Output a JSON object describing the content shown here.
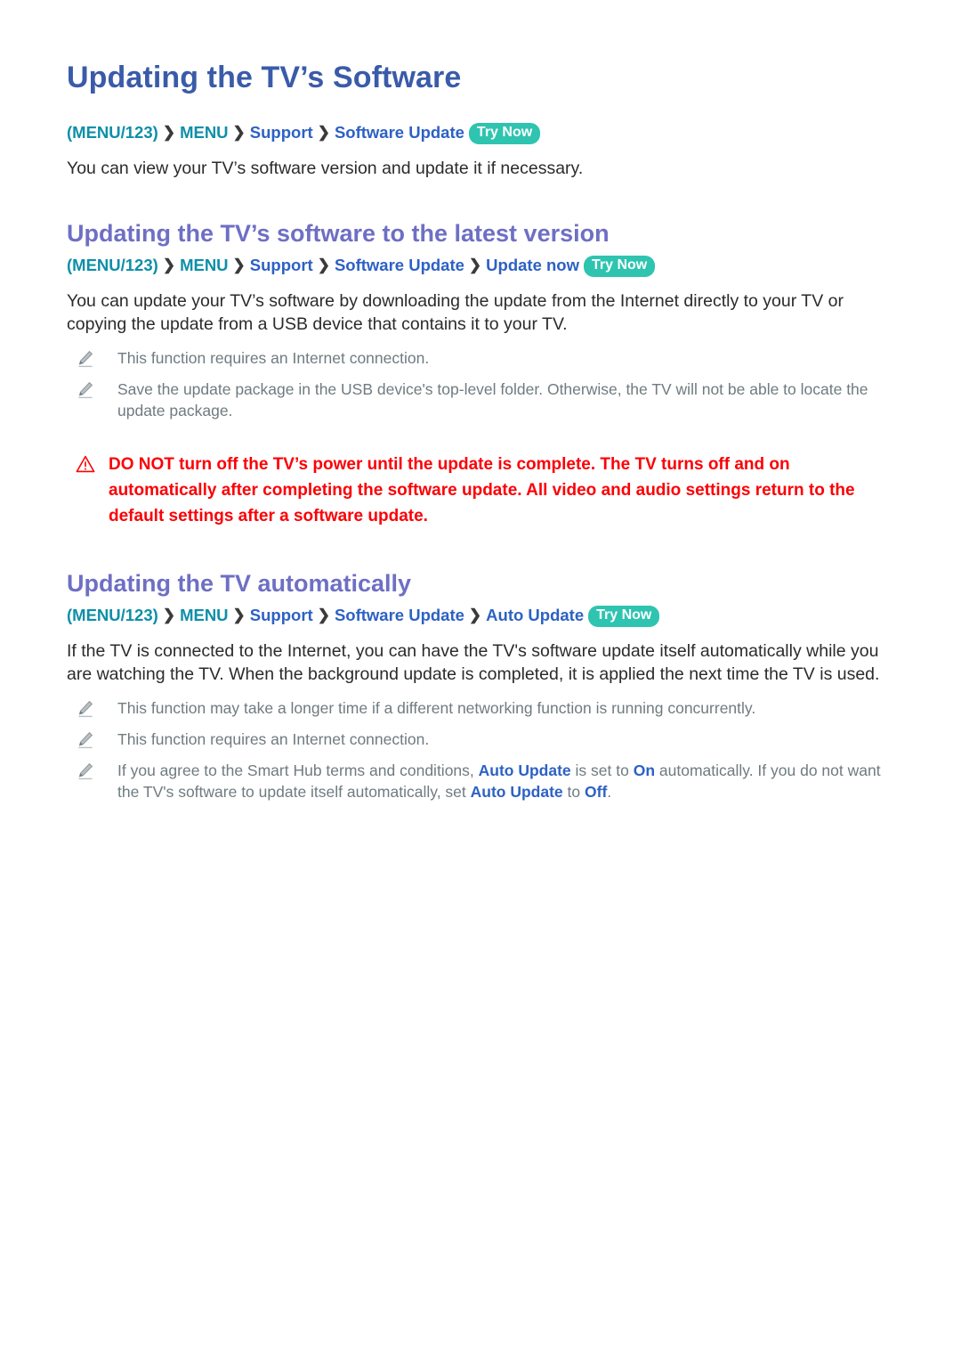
{
  "document": {
    "title": "Updating the TV’s Software",
    "intro_breadcrumb": {
      "items": [
        "(MENU/123)",
        "MENU",
        "Support",
        "Software Update"
      ],
      "separator": "❯",
      "badge": "Try Now"
    },
    "intro_text": "You can view your TV’s software version and update it if necessary."
  },
  "sections": [
    {
      "title": "Updating the TV’s software to the latest version",
      "breadcrumb": {
        "items": [
          "(MENU/123)",
          "MENU",
          "Support",
          "Software Update",
          "Update now"
        ],
        "separator": "❯",
        "badge": "Try Now"
      },
      "body": "You can update your TV’s software by downloading the update from the Internet directly to your TV or copying the update from a USB device that contains it to your TV.",
      "notes": [
        "This function requires an Internet connection.",
        "Save the update package in the USB device's top-level folder. Otherwise, the TV will not be able to locate the update package."
      ],
      "warning": "DO NOT turn off the TV’s power until the update is complete. The TV turns off and on automatically after completing the software update. All video and audio settings return to the default settings after a software update."
    },
    {
      "title": "Updating the TV automatically",
      "breadcrumb": {
        "items": [
          "(MENU/123)",
          "MENU",
          "Support",
          "Software Update",
          "Auto Update"
        ],
        "separator": "❯",
        "badge": "Try Now"
      },
      "body": "If the TV is connected to the Internet, you can have the TV's software update itself automatically while you are watching the TV. When the background update is completed, it is applied the next time the TV is used.",
      "notes": [
        "This function may take a longer time if a different networking function is running concurrently.",
        "This function requires an Internet connection."
      ],
      "note_rich": {
        "part1": "If you agree to the Smart Hub terms and conditions, ",
        "term1": "Auto Update",
        "part2": " is set to ",
        "term2": "On",
        "part3": " automatically. If you do not want the TV's software to update itself automatically, set ",
        "term3": "Auto Update",
        "part4": " to ",
        "term4": "Off",
        "part5": "."
      }
    }
  ],
  "colors": {
    "doc_title": "#3a5ba9",
    "section_title": "#6e6fc4",
    "crumb_teal": "#0e8fa8",
    "crumb_blue": "#2d61c4",
    "badge_bg": "#2ec4b0",
    "body_text": "#2b2b2b",
    "note_text": "#6f7b80",
    "warning": "#fb0005"
  },
  "icons": {
    "pencil": "pencil-icon",
    "warning": "warning-triangle-icon",
    "separator": "chevron-right-icon"
  }
}
